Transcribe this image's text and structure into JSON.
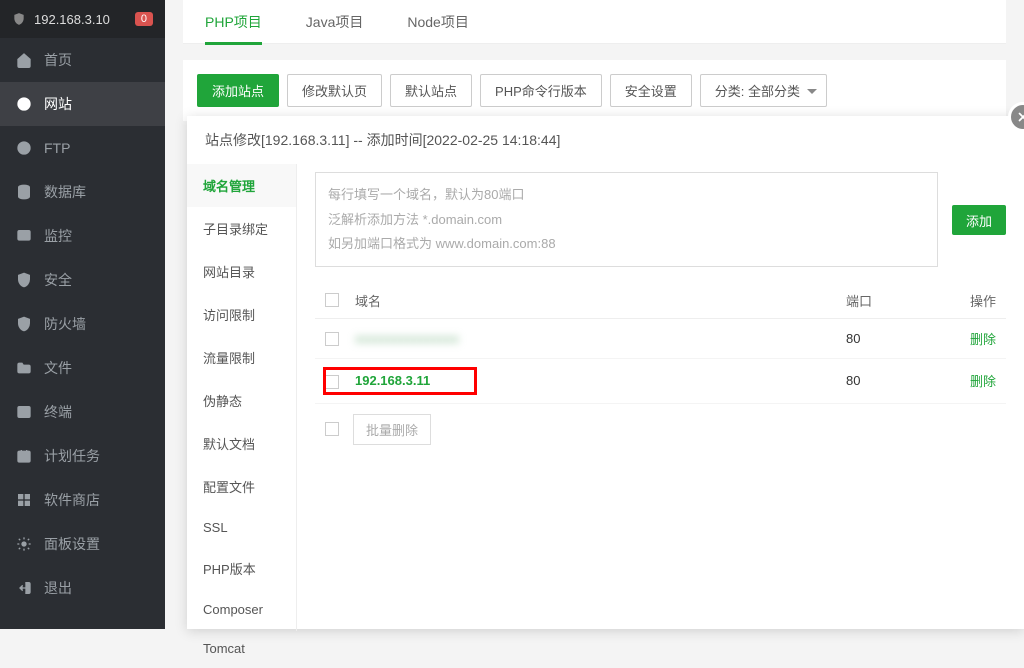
{
  "sidebar": {
    "server_ip": "192.168.3.10",
    "badge": "0",
    "items": [
      {
        "label": "首页",
        "icon": "home"
      },
      {
        "label": "网站",
        "icon": "globe",
        "active": true
      },
      {
        "label": "FTP",
        "icon": "ftp"
      },
      {
        "label": "数据库",
        "icon": "database"
      },
      {
        "label": "监控",
        "icon": "monitor"
      },
      {
        "label": "安全",
        "icon": "shield"
      },
      {
        "label": "防火墙",
        "icon": "firewall"
      },
      {
        "label": "文件",
        "icon": "folder"
      },
      {
        "label": "终端",
        "icon": "terminal"
      },
      {
        "label": "计划任务",
        "icon": "schedule"
      },
      {
        "label": "软件商店",
        "icon": "grid"
      },
      {
        "label": "面板设置",
        "icon": "settings"
      },
      {
        "label": "退出",
        "icon": "exit"
      }
    ]
  },
  "tabs": [
    {
      "label": "PHP项目",
      "active": true
    },
    {
      "label": "Java项目"
    },
    {
      "label": "Node项目"
    }
  ],
  "toolbar": {
    "add_site": "添加站点",
    "modify_default": "修改默认页",
    "default_site": "默认站点",
    "php_cli": "PHP命令行版本",
    "security": "安全设置",
    "category": "分类: 全部分类"
  },
  "modal": {
    "title": "站点修改[192.168.3.11]  --  添加时间[2022-02-25 14:18:44]",
    "nav": [
      "域名管理",
      "子目录绑定",
      "网站目录",
      "访问限制",
      "流量限制",
      "伪静态",
      "默认文档",
      "配置文件",
      "SSL",
      "PHP版本",
      "Composer",
      "Tomcat"
    ],
    "placeholder_lines": {
      "l1": "每行填写一个域名，默认为80端口",
      "l2": "泛解析添加方法 *.domain.com",
      "l3": "如另加端口格式为 www.domain.com:88"
    },
    "add_btn": "添加",
    "table": {
      "headers": {
        "domain": "域名",
        "port": "端口",
        "action": "操作"
      },
      "rows": [
        {
          "domain": "xxxxxxxxxxxxxxxx",
          "port": "80",
          "action": "删除",
          "blurred": true
        },
        {
          "domain": "192.168.3.11",
          "port": "80",
          "action": "删除",
          "highlighted": true
        }
      ],
      "batch_delete": "批量删除"
    }
  }
}
